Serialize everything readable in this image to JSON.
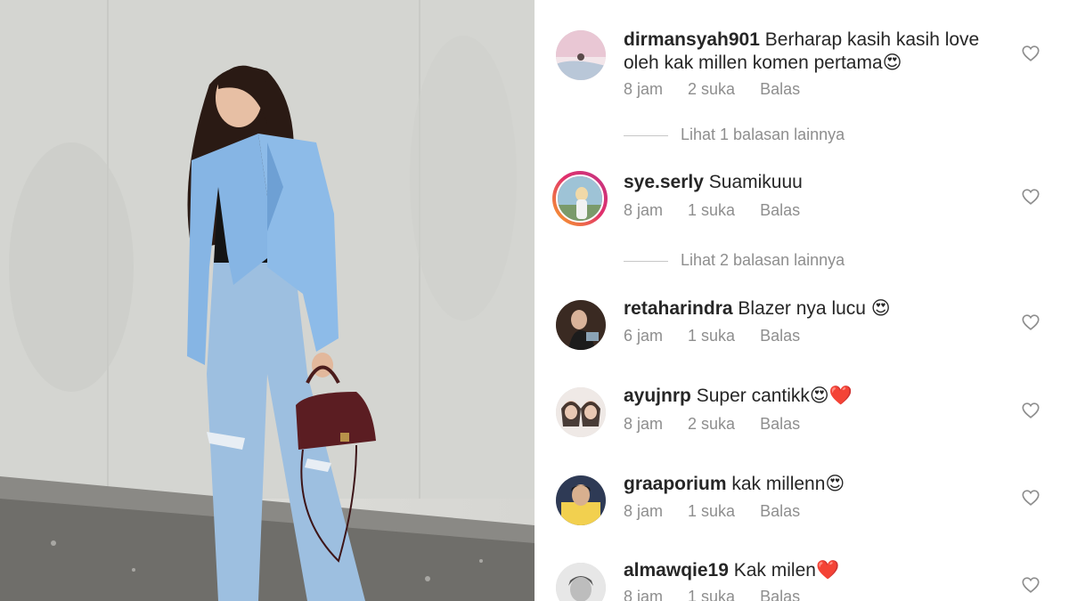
{
  "photo": {
    "alt_icon": "photo-of-woman-in-blue-blazer"
  },
  "comments": [
    {
      "username": "dirmansyah901",
      "text": "Berharap kasih kasih love oleh kak millen komen pertama😍",
      "time": "8 jam",
      "likes": "2 suka",
      "reply": "Balas",
      "view_replies": "Lihat 1 balasan lainnya"
    },
    {
      "username": "sye.serly",
      "text": "Suamikuuu",
      "time": "8 jam",
      "likes": "1 suka",
      "reply": "Balas",
      "view_replies": "Lihat 2 balasan lainnya"
    },
    {
      "username": "retaharindra",
      "text": "Blazer nya lucu 😍",
      "time": "6 jam",
      "likes": "1 suka",
      "reply": "Balas"
    },
    {
      "username": "ayujnrp",
      "text": "Super cantikk😍❤️",
      "time": "8 jam",
      "likes": "2 suka",
      "reply": "Balas"
    },
    {
      "username": "graaporium",
      "text": "kak millenn😍",
      "time": "8 jam",
      "likes": "1 suka",
      "reply": "Balas"
    },
    {
      "username": "almawqie19",
      "text": "Kak milen❤️",
      "time": "8 jam",
      "likes": "1 suka",
      "reply": "Balas"
    }
  ],
  "colors": {
    "username": "#262626",
    "meta": "#8e8e8e",
    "heart_outline": "#8e8e8e"
  }
}
